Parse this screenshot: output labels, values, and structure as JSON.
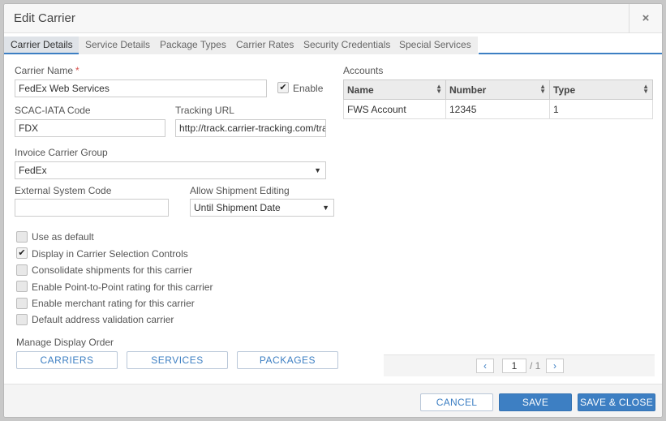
{
  "dialog": {
    "title": "Edit Carrier",
    "close_glyph": "×"
  },
  "tabs": [
    {
      "label": "Carrier Details",
      "active": true
    },
    {
      "label": "Service Details"
    },
    {
      "label": "Package Types"
    },
    {
      "label": "Carrier Rates"
    },
    {
      "label": "Security Credentials"
    },
    {
      "label": "Special Services"
    }
  ],
  "form": {
    "carrier_name_label": "Carrier Name",
    "required_mark": "*",
    "carrier_name_value": "FedEx Web Services",
    "enable_label": "Enable",
    "enable_checked": true,
    "scac_label": "SCAC-IATA Code",
    "scac_value": "FDX",
    "tracking_label": "Tracking URL",
    "tracking_value": "http://track.carrier-tracking.com/tra",
    "invoice_group_label": "Invoice Carrier Group",
    "invoice_group_value": "FedEx",
    "external_code_label": "External System Code",
    "external_code_value": "",
    "allow_editing_label": "Allow Shipment Editing",
    "allow_editing_value": "Until Shipment Date"
  },
  "options": [
    {
      "label": "Use as default",
      "checked": false
    },
    {
      "label": "Display in Carrier Selection Controls",
      "checked": true
    },
    {
      "label": "Consolidate shipments for this carrier",
      "checked": false
    },
    {
      "label": "Enable Point-to-Point rating for this carrier",
      "checked": false
    },
    {
      "label": "Enable merchant rating for this carrier",
      "checked": false
    },
    {
      "label": "Default address validation carrier",
      "checked": false
    }
  ],
  "display_order": {
    "label": "Manage Display Order",
    "buttons": [
      "CARRIERS",
      "SERVICES",
      "PACKAGES"
    ]
  },
  "accounts": {
    "label": "Accounts",
    "columns": [
      "Name",
      "Number",
      "Type"
    ],
    "rows": [
      [
        "FWS Account",
        "12345",
        "1"
      ]
    ],
    "pager": {
      "prev": "‹",
      "page": "1",
      "total": "/ 1",
      "next": "›"
    }
  },
  "footer": {
    "cancel_label": "CANCEL",
    "save_label": "SAVE",
    "save_close_label": "SAVE & CLOSE"
  },
  "colors": {
    "accent": "#3d7fc3",
    "required": "#d9534f"
  },
  "icons": {
    "close": "close-icon",
    "checkmark": "checkmark-icon",
    "dropdown": "chevron-down-icon",
    "sort": "sort-icon"
  }
}
